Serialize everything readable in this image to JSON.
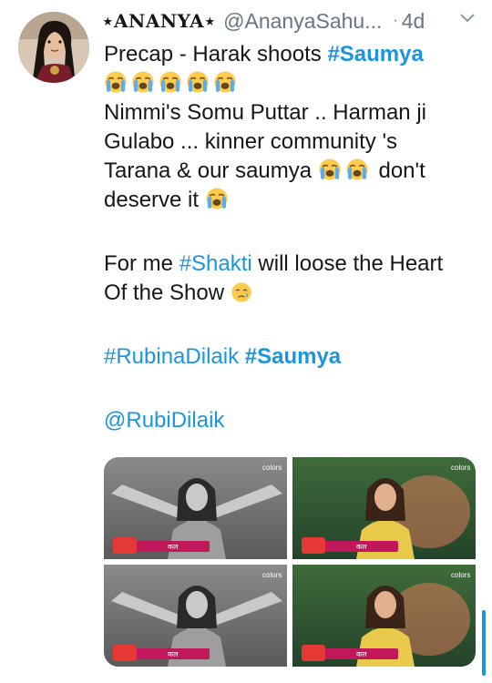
{
  "tweet": {
    "display_name": "⋆ANANYA⋆",
    "handle": "@AnanyaSahu...",
    "dot": "·",
    "time": "4d",
    "line1_text": "Precap -  Harak shoots ",
    "line1_tag": "#Saumya",
    "line3": "Nimmi's Somu Puttar .. Harman ji",
    "line4_a": "Gulabo ... kinner community 's",
    "line5_a": "Tarana & our saumya",
    "line5_b": "don't",
    "line6": "deserve it",
    "line8_a": "For me ",
    "line8_tag": "#Shakti",
    "line8_b": " will loose the Heart",
    "line9": "Of the Show",
    "hashtag_rubina": "#RubinaDilaik",
    "hashtag_saumya": "#Saumya",
    "mention": "@RubiDilaik"
  },
  "icons": {
    "avatar": "profile-photo",
    "menu": "chevron-down-icon",
    "crying_emoji": "loudly-crying-face",
    "tear_emoji": "crying-face"
  },
  "media": {
    "channel_logo": "colors",
    "caption_date": "कल",
    "tiles": [
      "bw-arms-open",
      "color-yellow-saree",
      "bw-arms-open",
      "color-yellow-saree"
    ]
  },
  "colors": {
    "link": "#1b95e0",
    "secondary": "#657786"
  }
}
